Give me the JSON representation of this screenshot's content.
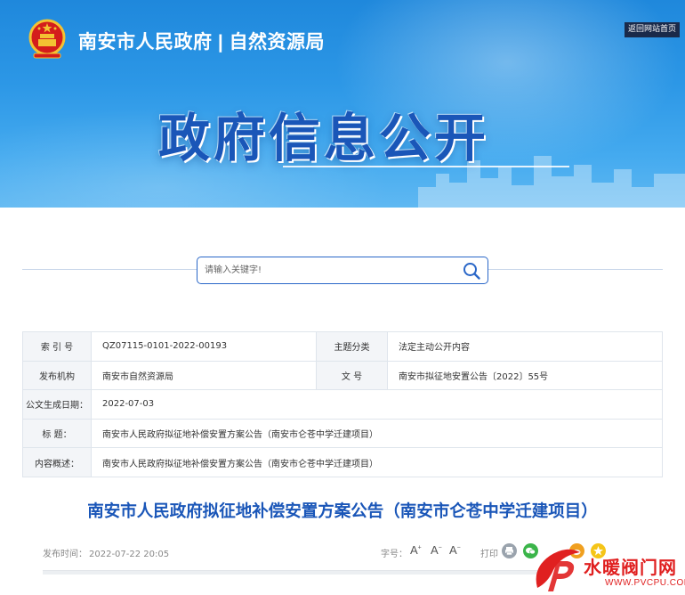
{
  "header": {
    "site_title": "南安市人民政府 | 自然资源局",
    "back_home_label": "返回网站首页",
    "banner_title": "政府信息公开"
  },
  "search": {
    "placeholder": "请输入关键字!"
  },
  "info_table": {
    "index_label": "索 引 号",
    "index_value": "QZ07115-0101-2022-00193",
    "category_label": "主题分类",
    "category_value": "法定主动公开内容",
    "publisher_label": "发布机构",
    "publisher_value": "南安市自然资源局",
    "doc_no_label": "文 号",
    "doc_no_value": "南安市拟征地安置公告〔2022〕55号",
    "date_label": "公文生成日期：",
    "date_value": "2022-07-03",
    "title_label": "标 题：",
    "title_value": "南安市人民政府拟征地补偿安置方案公告（南安市仑苍中学迁建项目）",
    "summary_label": "内容概述：",
    "summary_value": "南安市人民政府拟征地补偿安置方案公告（南安市仑苍中学迁建项目）"
  },
  "article": {
    "title": "南安市人民政府拟征地补偿安置方案公告（南安市仑苍中学迁建项目）",
    "publish_label": "发布时间：",
    "publish_time": "2022-07-22 20:05",
    "font_size_label": "字号：",
    "font_large": "A",
    "font_medium": "A",
    "font_small": "A",
    "print_label": "打印"
  },
  "watermark": {
    "text": "水暖阀门网",
    "url": "WWW.PVCPU.COM"
  },
  "colors": {
    "accent": "#1a56b8",
    "banner": "#2c97e6",
    "wechat": "#3bb54a",
    "weibo": "#f0a020",
    "qzone": "#f5c518",
    "watermark": "#e02020"
  }
}
